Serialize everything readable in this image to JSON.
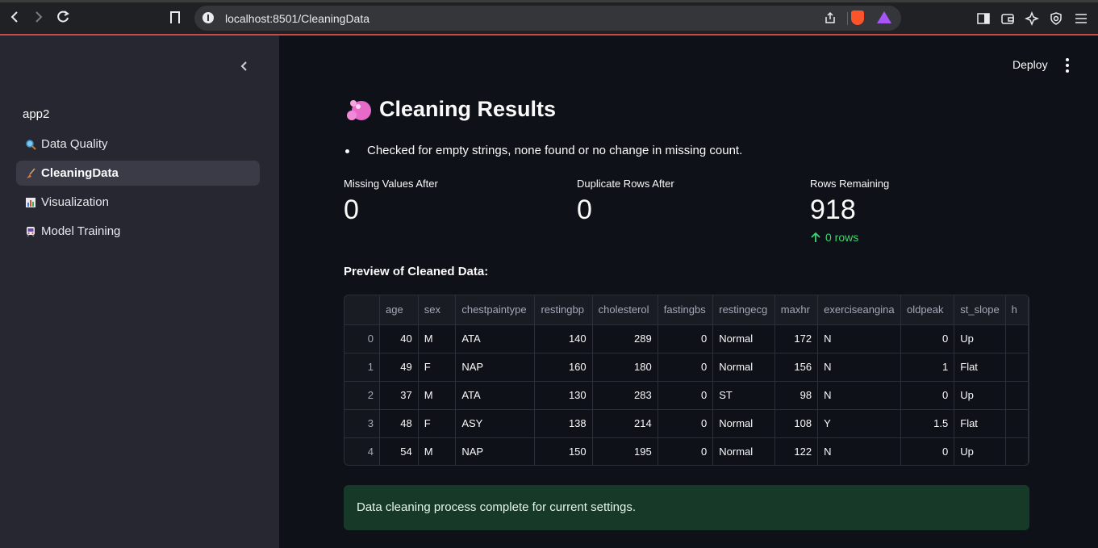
{
  "browser": {
    "url": "localhost:8501/CleaningData"
  },
  "sidebar": {
    "app_name": "app2",
    "items": [
      {
        "label": "Data Quality",
        "icon": "magnifier-icon",
        "active": false
      },
      {
        "label": "CleaningData",
        "icon": "broom-icon",
        "active": true
      },
      {
        "label": "Visualization",
        "icon": "bar-chart-icon",
        "active": false
      },
      {
        "label": "Model Training",
        "icon": "train-icon",
        "active": false
      }
    ]
  },
  "header": {
    "deploy_label": "Deploy"
  },
  "main": {
    "title": "Cleaning Results",
    "title_icon": "soap-bubbles-icon",
    "bullet": "Checked for empty strings, none found or no change in missing count.",
    "metrics": [
      {
        "label": "Missing Values After",
        "value": "0"
      },
      {
        "label": "Duplicate Rows After",
        "value": "0"
      },
      {
        "label": "Rows Remaining",
        "value": "918",
        "delta": "0 rows"
      }
    ],
    "preview_label": "Preview of Cleaned Data:",
    "table": {
      "columns": [
        "",
        "age",
        "sex",
        "chestpaintype",
        "restingbp",
        "cholesterol",
        "fastingbs",
        "restingecg",
        "maxhr",
        "exerciseangina",
        "oldpeak",
        "st_slope",
        "h"
      ],
      "rows": [
        [
          "0",
          "40",
          "M",
          "ATA",
          "140",
          "289",
          "0",
          "Normal",
          "172",
          "N",
          "0",
          "Up",
          ""
        ],
        [
          "1",
          "49",
          "F",
          "NAP",
          "160",
          "180",
          "0",
          "Normal",
          "156",
          "N",
          "1",
          "Flat",
          ""
        ],
        [
          "2",
          "37",
          "M",
          "ATA",
          "130",
          "283",
          "0",
          "ST",
          "98",
          "N",
          "0",
          "Up",
          ""
        ],
        [
          "3",
          "48",
          "F",
          "ASY",
          "138",
          "214",
          "0",
          "Normal",
          "108",
          "Y",
          "1.5",
          "Flat",
          ""
        ],
        [
          "4",
          "54",
          "M",
          "NAP",
          "150",
          "195",
          "0",
          "Normal",
          "122",
          "N",
          "0",
          "Up",
          ""
        ]
      ]
    },
    "success_message": "Data cleaning process complete for current settings."
  },
  "colors": {
    "sidebar_bg": "#262730",
    "main_bg": "#0e1117",
    "delta_green": "#3dd56d",
    "success_bg": "#173928"
  }
}
